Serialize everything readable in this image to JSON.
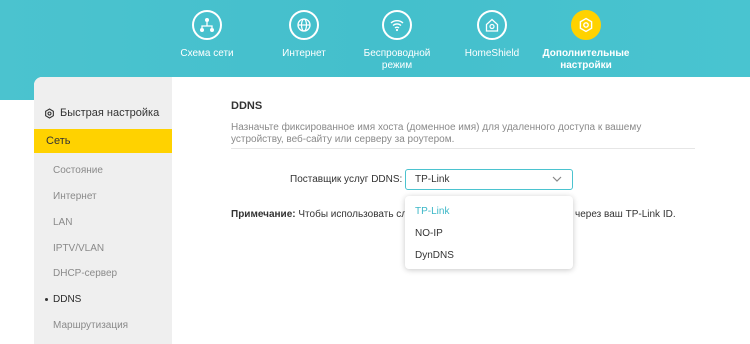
{
  "nav": {
    "items": [
      {
        "label": "Схема сети",
        "icon": "network-map-icon"
      },
      {
        "label": "Интернет",
        "icon": "globe-icon"
      },
      {
        "label": "Беспроводной\nрежим",
        "icon": "wifi-icon"
      },
      {
        "label": "HomeShield",
        "icon": "homeshield-icon"
      },
      {
        "label": "Дополнительные\nнастройки",
        "icon": "gear-icon",
        "active": true
      }
    ]
  },
  "sidebar": {
    "quick_setup": "Быстрая настройка",
    "section": "Сеть",
    "items": [
      "Состояние",
      "Интернет",
      "LAN",
      "IPTV/VLAN",
      "DHCP-сервер",
      "DDNS",
      "Маршрутизация"
    ],
    "selected": "DDNS"
  },
  "content": {
    "title": "DDNS",
    "description": "Назначьте фиксированное имя хоста (доменное имя) для удаленного доступа к вашему устройству, веб-сайту или серверу за роутером.",
    "provider_label": "Поставщик услуг DDNS:",
    "provider_value": "TP-Link",
    "note_label": "Примечание:",
    "note_text": "Чтобы использовать слу",
    "note_tail": "через ваш TP-Link ID."
  },
  "dropdown": {
    "options": [
      "TP-Link",
      "NO-IP",
      "DynDNS"
    ],
    "selected": "TP-Link"
  },
  "colors": {
    "accent": "#4bc3cf",
    "active_yellow": "#ffd200"
  }
}
